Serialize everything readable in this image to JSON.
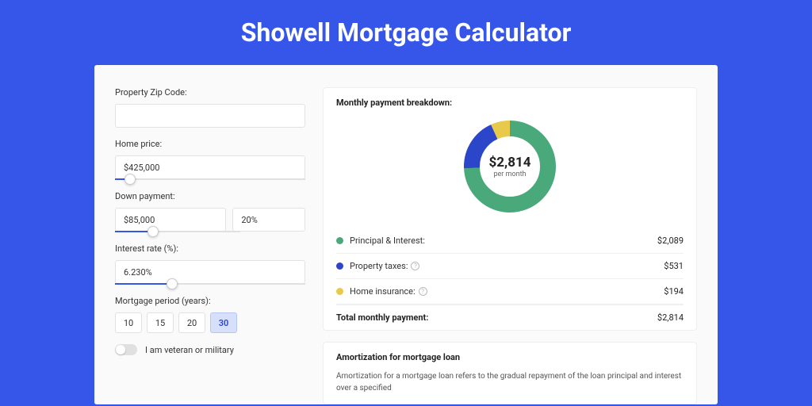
{
  "title": "Showell Mortgage Calculator",
  "form": {
    "zip_label": "Property Zip Code:",
    "zip_value": "",
    "home_price_label": "Home price:",
    "home_price_value": "$425,000",
    "home_price_slider_pct": 8,
    "down_payment_label": "Down payment:",
    "down_payment_value": "$85,000",
    "down_payment_pct": "20%",
    "down_payment_slider_pct": 20,
    "interest_label": "Interest rate (%):",
    "interest_value": "6.230%",
    "interest_slider_pct": 30,
    "period_label": "Mortgage period (years):",
    "periods": [
      "10",
      "15",
      "20",
      "30"
    ],
    "period_active_index": 3,
    "veteran_label": "I am veteran or military"
  },
  "breakdown": {
    "title": "Monthly payment breakdown:",
    "donut_amount": "$2,814",
    "donut_sub": "per month",
    "items": [
      {
        "label": "Principal & Interest:",
        "value": "$2,089",
        "help": false
      },
      {
        "label": "Property taxes:",
        "value": "$531",
        "help": true
      },
      {
        "label": "Home insurance:",
        "value": "$194",
        "help": true
      }
    ],
    "total_label": "Total monthly payment:",
    "total_value": "$2,814"
  },
  "amortization": {
    "title": "Amortization for mortgage loan",
    "body": "Amortization for a mortgage loan refers to the gradual repayment of the loan principal and interest over a specified"
  },
  "chart_data": {
    "type": "pie",
    "title": "Monthly payment breakdown",
    "series": [
      {
        "name": "Principal & Interest",
        "value": 2089,
        "color": "#4aa97a"
      },
      {
        "name": "Property taxes",
        "value": 531,
        "color": "#2b46c9"
      },
      {
        "name": "Home insurance",
        "value": 194,
        "color": "#e8c94a"
      }
    ],
    "total": 2814,
    "center_label": "$2,814 per month"
  }
}
